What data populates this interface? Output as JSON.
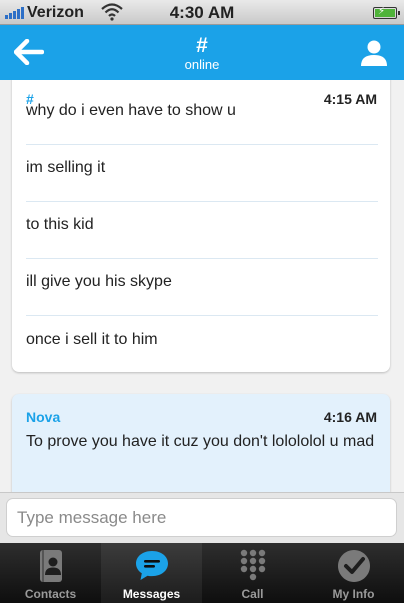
{
  "status_bar": {
    "carrier": "Verizon",
    "time": "4:30 AM"
  },
  "header": {
    "title": "#",
    "subtitle": "online"
  },
  "messages": [
    {
      "sender": "#",
      "time": "4:15 AM",
      "lines": [
        "why do i even have to show u",
        "im selling it",
        "to this kid",
        "ill give you his skype",
        "once i sell it to him"
      ]
    },
    {
      "sender": "Nova",
      "time": "4:16 AM",
      "text": "To prove you have it cuz you don't lolololol u mad"
    }
  ],
  "composer": {
    "placeholder": "Type message here"
  },
  "tabs": [
    {
      "label": "Contacts",
      "icon": "contacts-icon",
      "active": false
    },
    {
      "label": "Messages",
      "icon": "messages-icon",
      "active": true
    },
    {
      "label": "Call",
      "icon": "dialpad-icon",
      "active": false
    },
    {
      "label": "My Info",
      "icon": "my-info-icon",
      "active": false
    }
  ],
  "colors": {
    "accent": "#1ba2e8",
    "incoming_bubble": "#e3f1fc",
    "battery": "#4fb33a"
  }
}
